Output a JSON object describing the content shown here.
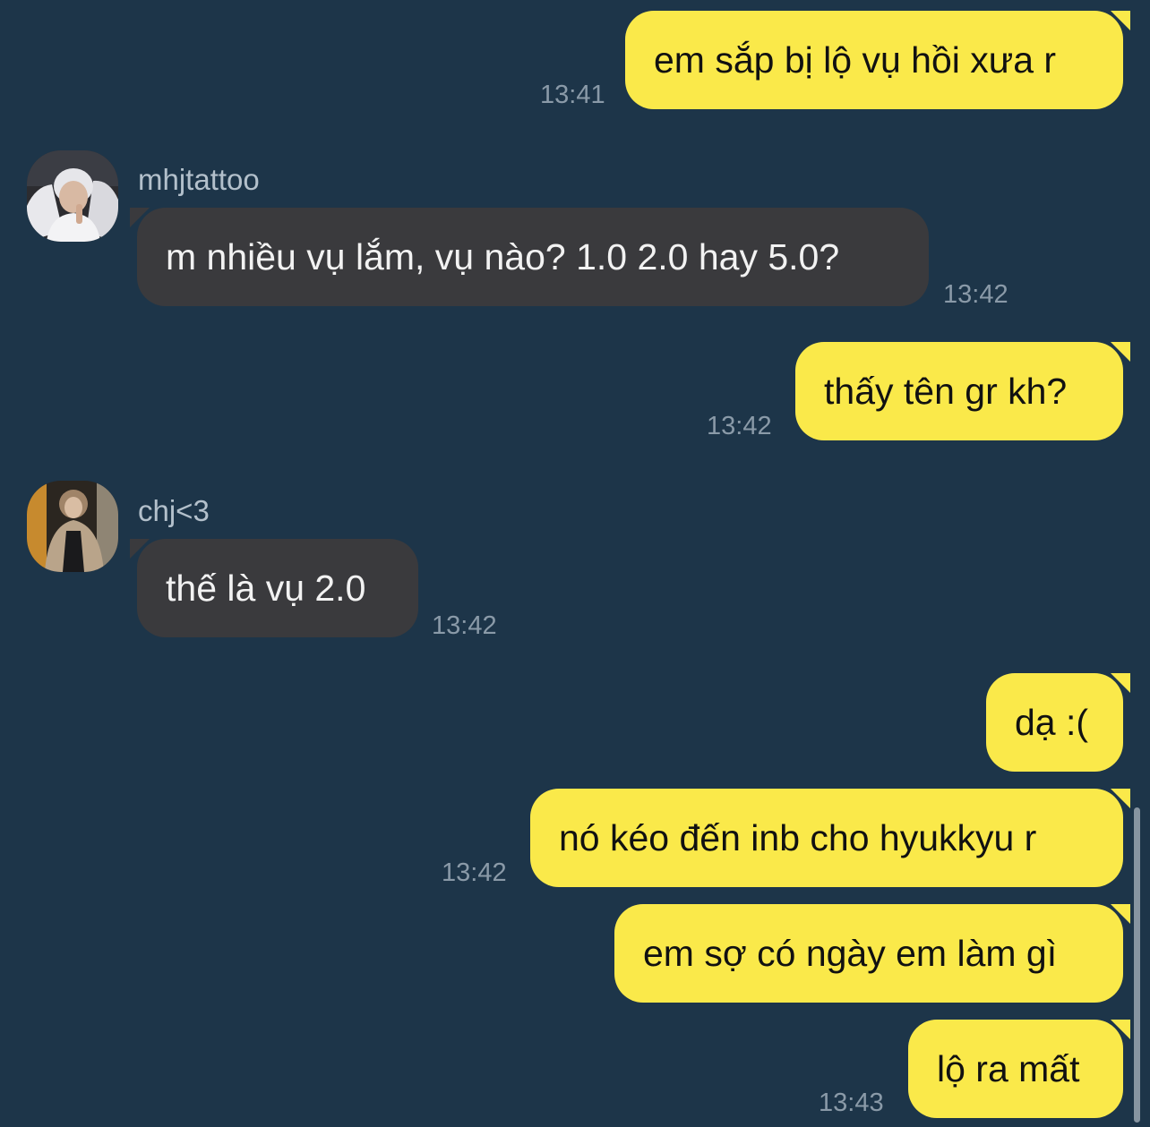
{
  "messages": [
    {
      "direction": "out",
      "text": "em sắp bị lộ vụ hồi xưa r",
      "time": "13:41"
    },
    {
      "direction": "in",
      "sender": "mhjtattoo",
      "avatar_icon": "user-photo-avatar",
      "text": "m nhiều vụ lắm, vụ nào? 1.0 2.0 hay 5.0?",
      "time": "13:42"
    },
    {
      "direction": "out",
      "text": "thấy tên gr kh?",
      "time": "13:42"
    },
    {
      "direction": "in",
      "sender": "chj<3",
      "avatar_icon": "user-photo-avatar",
      "text": "thế là vụ 2.0",
      "time": "13:42"
    },
    {
      "direction": "out",
      "text": "dạ :("
    },
    {
      "direction": "out",
      "text": "nó kéo đến inb cho hyukkyu r",
      "time": "13:42"
    },
    {
      "direction": "out",
      "text": "em sợ có ngày em làm gì"
    },
    {
      "direction": "out",
      "text": "lộ ra mất",
      "time": "13:43"
    }
  ],
  "colors": {
    "background": "#1d3549",
    "outgoing_bubble": "#fae94a",
    "incoming_bubble": "#3a3a3d",
    "timestamp": "#8a9aa8",
    "sender_name": "#b3c0cb"
  }
}
